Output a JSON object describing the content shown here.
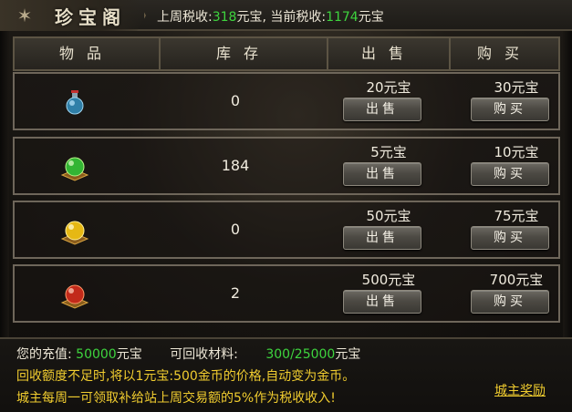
{
  "title": "珍宝阁",
  "tax": {
    "last_week_label": "上周税收:",
    "last_week_value": "318",
    "last_week_unit": "元宝,",
    "current_label": "当前税收:",
    "current_value": "1174",
    "current_unit": "元宝"
  },
  "header": {
    "item": "物品",
    "stock": "库存",
    "sell": "出售",
    "buy": "购买"
  },
  "rows": [
    {
      "icon": "blue-potion-icon",
      "stock": "0",
      "sell_price": "20元宝",
      "buy_price": "30元宝",
      "sell_label": "出售",
      "buy_label": "购买"
    },
    {
      "icon": "green-orb-icon",
      "stock": "184",
      "sell_price": "5元宝",
      "buy_price": "10元宝",
      "sell_label": "出售",
      "buy_label": "购买"
    },
    {
      "icon": "yellow-orb-icon",
      "stock": "0",
      "sell_price": "50元宝",
      "buy_price": "75元宝",
      "sell_label": "出售",
      "buy_label": "购买"
    },
    {
      "icon": "red-orb-icon",
      "stock": "2",
      "sell_price": "500元宝",
      "buy_price": "700元宝",
      "sell_label": "出售",
      "buy_label": "购买"
    }
  ],
  "footer": {
    "recharge_label": "您的充值:",
    "recharge_value": "50000",
    "recharge_unit": "元宝",
    "material_label": "可回收材料:",
    "material_value": "300/25000",
    "material_unit": "元宝",
    "notice1": "回收额度不足时,将以1元宝:500金币的价格,自动变为金币。",
    "notice2": "城主每周一可领取补给站上周交易额的5%作为税收收入!",
    "reward_link": "城主奖励"
  },
  "colors": {
    "accent_green": "#3ed43e",
    "accent_yellow": "#f0cc2f"
  }
}
